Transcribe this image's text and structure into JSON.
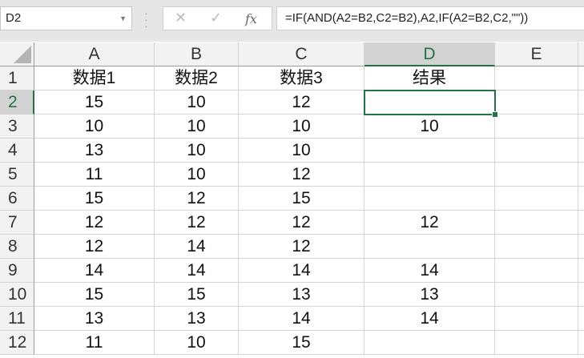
{
  "name_box": "D2",
  "formula": "=IF(AND(A2=B2,C2=B2),A2,IF(A2=B2,C2,\"\"))",
  "icons": {
    "cancel": "✕",
    "enter": "✓",
    "fx": "fx"
  },
  "columns": [
    "A",
    "B",
    "C",
    "D",
    "E"
  ],
  "rows": [
    "1",
    "2",
    "3",
    "4",
    "5",
    "6",
    "7",
    "8",
    "9",
    "10",
    "11",
    "12"
  ],
  "cells": [
    [
      "数据1",
      "数据2",
      "数据3",
      "结果",
      ""
    ],
    [
      "15",
      "10",
      "12",
      "",
      ""
    ],
    [
      "10",
      "10",
      "10",
      "10",
      ""
    ],
    [
      "13",
      "10",
      "10",
      "",
      ""
    ],
    [
      "11",
      "10",
      "12",
      "",
      ""
    ],
    [
      "15",
      "12",
      "15",
      "",
      ""
    ],
    [
      "12",
      "12",
      "12",
      "12",
      ""
    ],
    [
      "12",
      "14",
      "12",
      "",
      ""
    ],
    [
      "14",
      "14",
      "14",
      "14",
      ""
    ],
    [
      "15",
      "15",
      "13",
      "13",
      ""
    ],
    [
      "13",
      "13",
      "14",
      "14",
      ""
    ],
    [
      "11",
      "10",
      "15",
      "",
      ""
    ]
  ]
}
